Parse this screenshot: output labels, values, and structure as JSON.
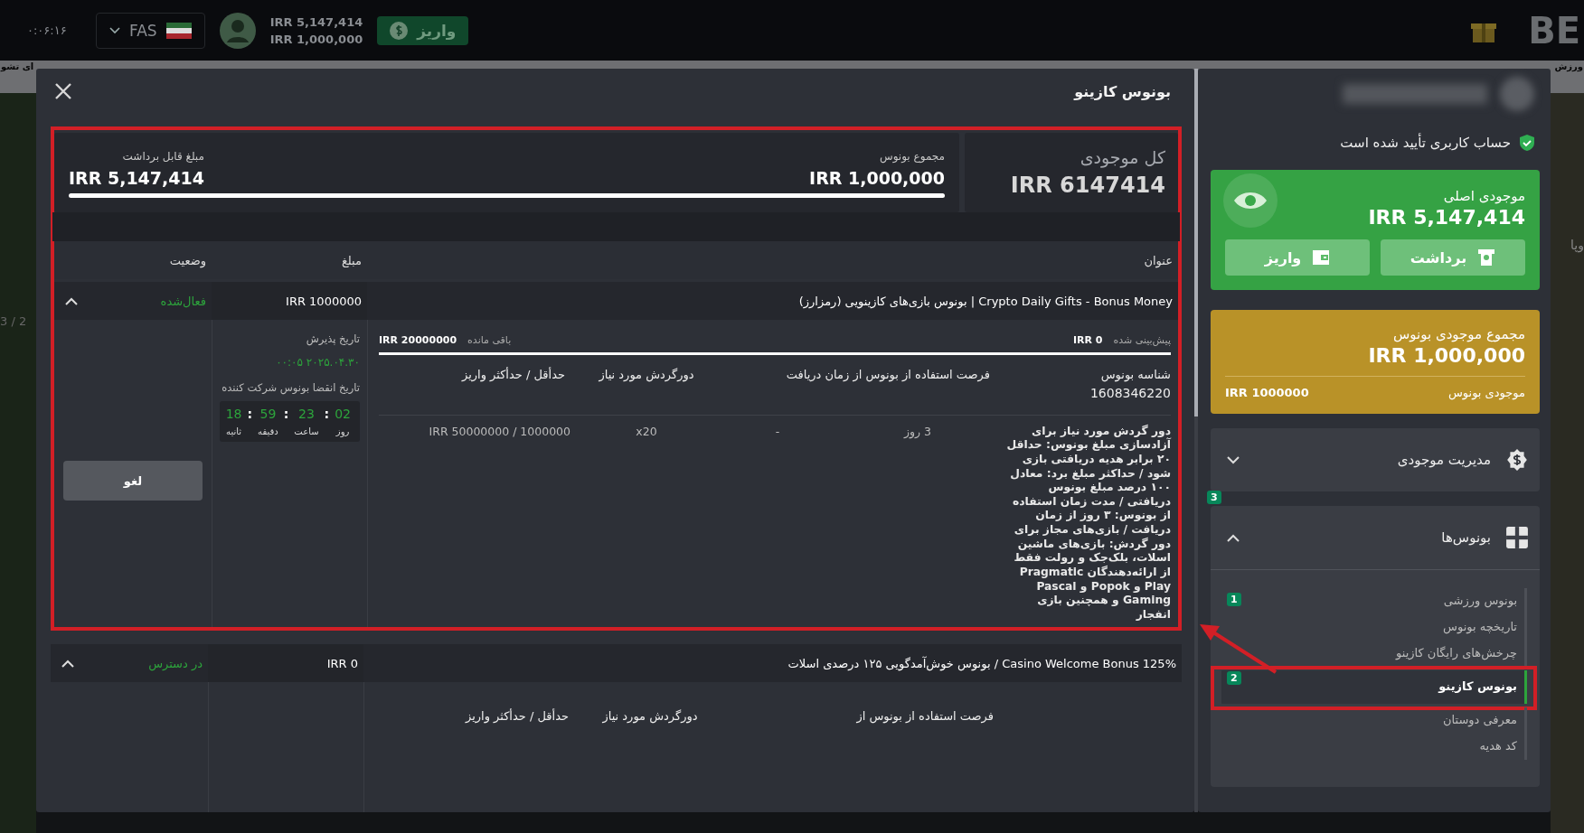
{
  "topbar": {
    "time": "۰:۰۶:۱۶",
    "language": "FAS",
    "balances": [
      "IRR 5,147,414",
      "IRR 1,000,000"
    ],
    "deposit": "واریز",
    "logo": "BE"
  },
  "background": {
    "strip_left": "ای تشو",
    "strip_right": "ورزش",
    "slide_counter": "3 / 2",
    "side_right": "وپا"
  },
  "modal": {
    "title": "بونوس کازینو",
    "highlighted": true,
    "summary": {
      "total_label": "کل موجودی",
      "total_value": "IRR 6147414",
      "bonus_label": "مجموع بونوس",
      "bonus_value": "IRR 1,000,000",
      "withdraw_label": "مبلغ قابل برداشت",
      "withdraw_value": "IRR 5,147,414"
    },
    "columns": [
      "عنوان",
      "مبلغ",
      "وضعیت"
    ],
    "rows": [
      {
        "title": "Crypto Daily Gifts - Bonus Money | بونوس بازی‌های کازینویی (رمزارز)",
        "amount": "IRR 1000000",
        "status": "فعال‌شده",
        "expanded": true,
        "wager_label": "پیش‌بینی شده",
        "wager_value": "IRR 0",
        "remaining_label": "باقی مانده",
        "remaining_value": "IRR 20000000",
        "id_header": "شناسه بونوس",
        "headers": [
          "فرصت استفاده از بونوس از زمان دریافت",
          "دورگردش مورد نیاز",
          "حدأقل / حدأکثر واریز"
        ],
        "bonus_id": "1608346220",
        "values": [
          "دور گردش مورد نیاز برای آزادسازی مبلغ بونوس: حداقل ۲۰ برابر هدیه دریافتی بازی شود / حداکثر مبلغ برد: معادل ۱۰۰ درصد مبلغ بونوس دریافتی / مدت زمان استفاده از بونوس: ۳ روز از زمان دریافت / بازی‌های مجاز برای دور گردش: بازی‌های ماشین اسلات، بلک‌جک و رولت فقط از ارائه‌دهندگان Pragmatic Play و Popok و Pascal Gaming و همچنین بازی انفجار",
          "3 روز",
          "-",
          "x20",
          "IRR 50000000 / 1000000"
        ],
        "accepted_label": "تاریخ پذیرش",
        "accepted_value": "۲۰۲۵.۰۴.۳۰ ۰۰:۰۵",
        "expiry_label": "تاریخ انقضا بونوس شرکت کننده",
        "separator": ":",
        "countdown": [
          {
            "value": "02",
            "unit": "روز"
          },
          {
            "value": "23",
            "unit": "ساعت"
          },
          {
            "value": "59",
            "unit": "دقیقه"
          },
          {
            "value": "18",
            "unit": "ثانیه"
          }
        ],
        "cancel": "لغو"
      },
      {
        "title": "Casino Welcome Bonus 125% /  بونوس خوش‌آمدگویی ۱۲۵ درصدی اسلات",
        "amount": "IRR 0",
        "status": "در دسترس",
        "expanded": true,
        "headers": [
          "فرصت استفاده از بونوس از",
          "دورگردش مورد نیاز",
          "حدأقل / حدأکثر واریز"
        ]
      }
    ]
  },
  "sidebar": {
    "verified": "حساب کاربری تأیید شده است",
    "main": {
      "label": "موجودی اصلی",
      "value": "IRR 5,147,414",
      "buttons": [
        "برداشت",
        "واریز"
      ]
    },
    "bonus": {
      "label": "مجموع موجودی بونوس",
      "value": "IRR 1,000,000",
      "sub_label": "موجودی بونوس",
      "sub_value": "IRR 1000000"
    },
    "sections": [
      {
        "kind": "balance",
        "label": "مدیریت موجودی",
        "expanded": false
      },
      {
        "kind": "bonus",
        "label": "بونوس‌ها",
        "expanded": true,
        "badge": "3",
        "items": [
          {
            "label": "بونوس ورزشی",
            "selected": false,
            "badge": "1"
          },
          {
            "label": "تاریخچه بونوس",
            "selected": false
          },
          {
            "label": "چرخش‌های رایگان کازینو",
            "selected": false
          },
          {
            "label": "بونوس کازینو",
            "selected": true,
            "badge": "2",
            "highlighted": true
          },
          {
            "label": "معرفی دوستان",
            "selected": false
          },
          {
            "label": "کد هدیه",
            "selected": false
          }
        ]
      }
    ]
  },
  "annotations": {
    "arrow": true
  }
}
